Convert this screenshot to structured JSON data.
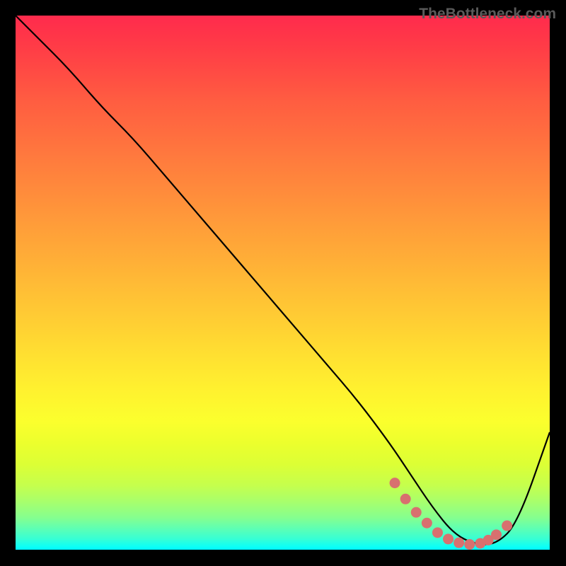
{
  "watermark": "TheBottleneck.com",
  "chart_data": {
    "type": "line",
    "title": "",
    "xlabel": "",
    "ylabel": "",
    "xlim": [
      0,
      100
    ],
    "ylim": [
      0,
      100
    ],
    "series": [
      {
        "name": "bottleneck-curve",
        "x": [
          0,
          4,
          10,
          16,
          22,
          28,
          34,
          40,
          46,
          52,
          58,
          64,
          70,
          74,
          78,
          82,
          86,
          90,
          94,
          100
        ],
        "y": [
          100,
          96,
          90,
          83,
          77,
          70,
          63,
          56,
          49,
          42,
          35,
          28,
          20,
          14,
          8,
          3,
          1,
          1,
          5,
          22
        ]
      }
    ],
    "scatter": {
      "name": "highlighted-points",
      "x": [
        71,
        73,
        75,
        77,
        79,
        81,
        83,
        85,
        87,
        88.5,
        90,
        92
      ],
      "y": [
        12.5,
        9.5,
        7,
        5,
        3.2,
        2,
        1.3,
        1,
        1.2,
        1.8,
        2.8,
        4.5
      ]
    }
  }
}
